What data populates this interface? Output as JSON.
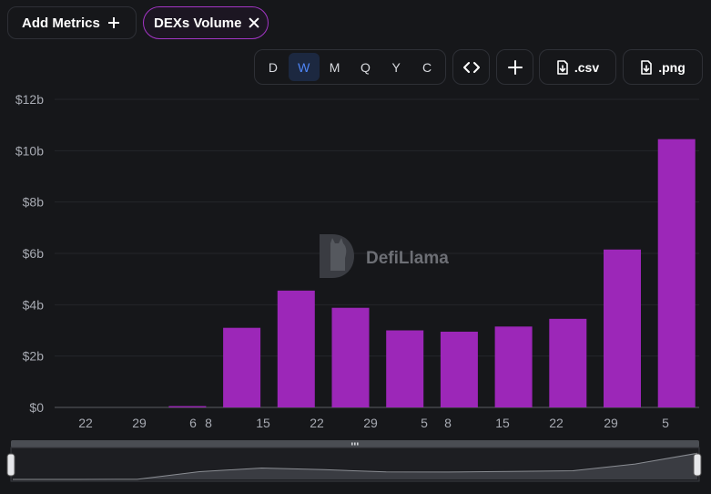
{
  "header": {
    "add_metrics_label": "Add Metrics",
    "active_metric_label": "DEXs Volume"
  },
  "toolbar": {
    "periods": [
      "D",
      "W",
      "M",
      "Q",
      "Y",
      "C"
    ],
    "active_period": "W",
    "csv_label": ".csv",
    "png_label": ".png"
  },
  "watermark": "DefiLlama",
  "colors": {
    "bar": "#9c27b8",
    "background": "#16171a",
    "active_border": "#a235c4",
    "active_period": "#4f86f7"
  },
  "chart_data": {
    "type": "bar",
    "title": "",
    "xlabel": "",
    "ylabel": "",
    "ylim": [
      0,
      12
    ],
    "y_unit": "b",
    "y_ticks": [
      "$0",
      "$2b",
      "$4b",
      "$6b",
      "$8b",
      "$10b",
      "$12b"
    ],
    "x_tick_labels": [
      "22",
      "29",
      "6",
      "8",
      "15",
      "22",
      "29",
      "5",
      "8",
      "15",
      "22",
      "29",
      "5"
    ],
    "values": [
      0,
      0,
      0.05,
      3.1,
      4.55,
      3.88,
      3.0,
      2.95,
      3.15,
      3.45,
      6.15,
      10.45
    ],
    "grid": true,
    "legend": "none"
  }
}
